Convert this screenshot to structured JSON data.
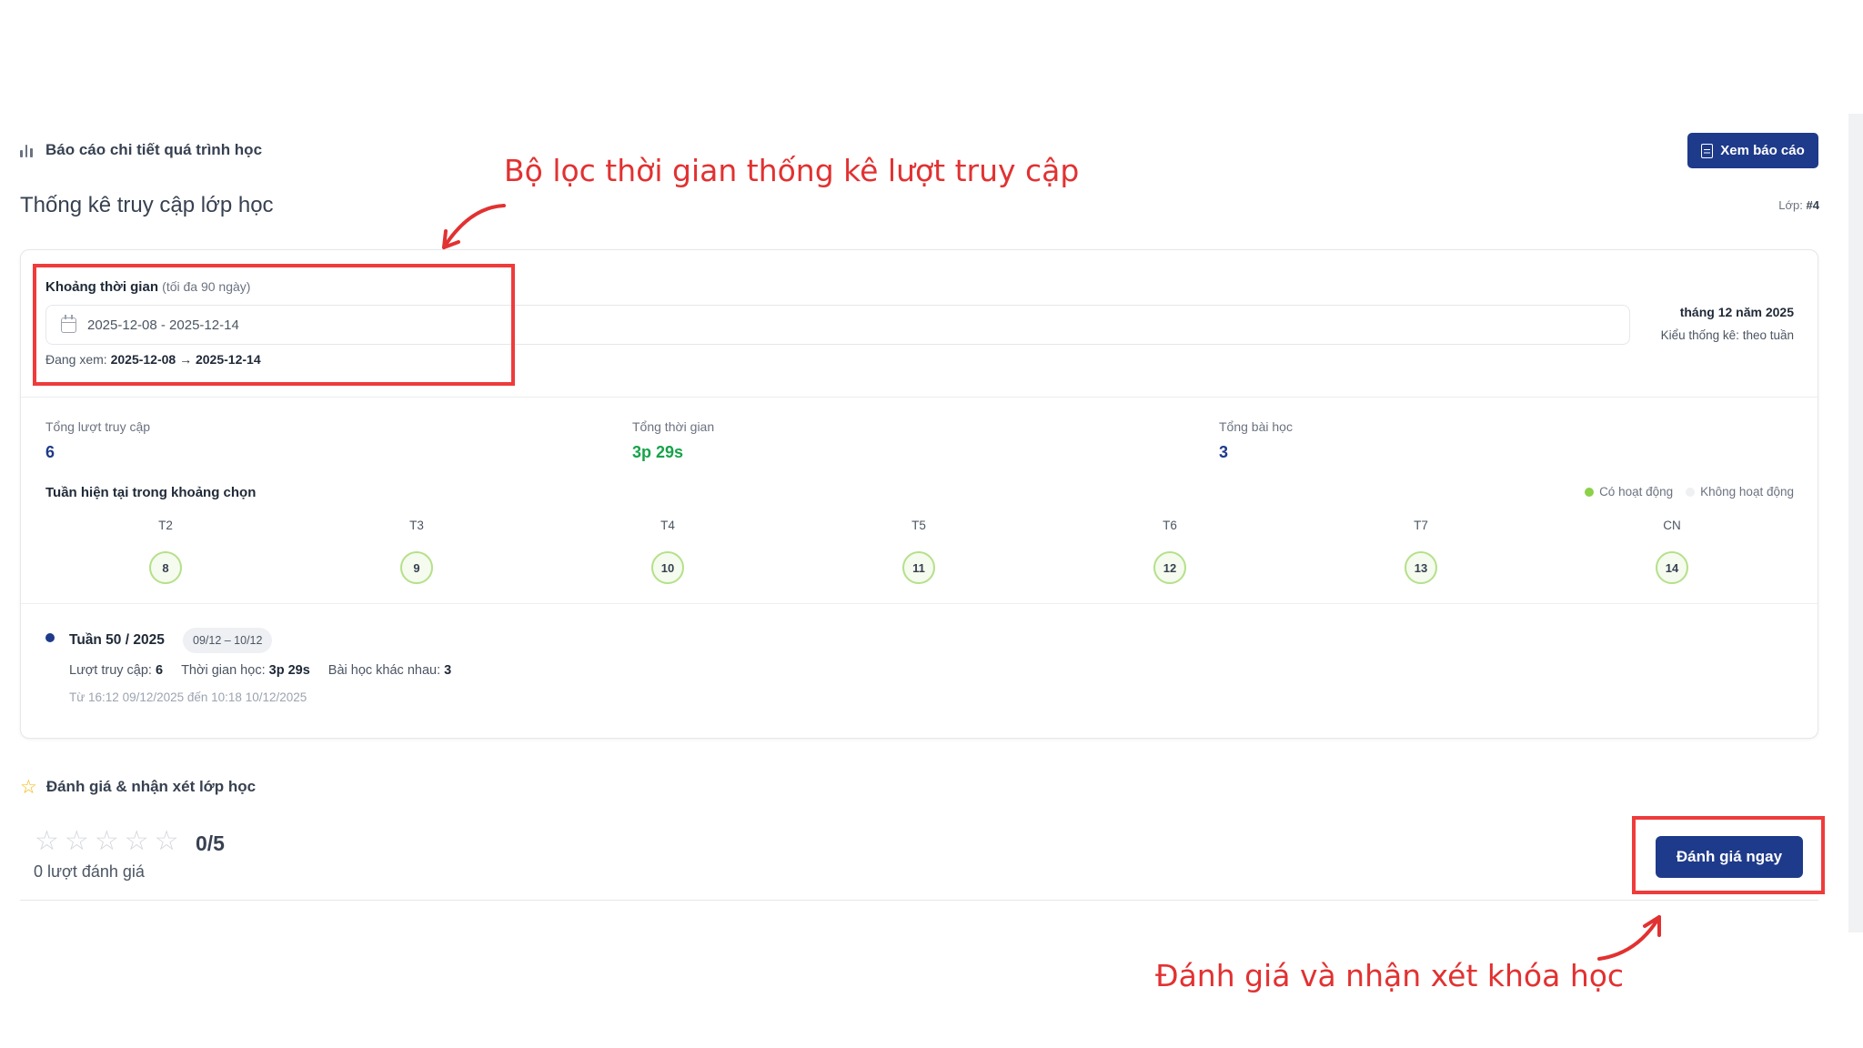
{
  "report": {
    "title": "Báo cáo chi tiết quá trình học",
    "view_button": "Xem báo cáo"
  },
  "access": {
    "title": "Thống kê truy cập lớp học",
    "class_label": "Lớp:",
    "class_value": "#4"
  },
  "filter": {
    "label": "Khoảng thời gian",
    "hint": "(tối đa 90 ngày)",
    "date_range": "2025-12-08 - 2025-12-14",
    "viewing_label": "Đang xem:",
    "viewing_range": "2025-12-08 → 2025-12-14",
    "month": "tháng 12 năm 2025",
    "stat_mode": "Kiểu thống kê: theo tuần"
  },
  "metrics": [
    {
      "label": "Tổng lượt truy cập",
      "value": "6"
    },
    {
      "label": "Tổng thời gian",
      "value": "3p 29s"
    },
    {
      "label": "Tổng bài học",
      "value": "3"
    }
  ],
  "week_view": {
    "title": "Tuần hiện tại trong khoảng chọn",
    "legend_active": "Có hoạt động",
    "legend_inactive": "Không hoạt động",
    "days": [
      {
        "label": "T2",
        "date": "8"
      },
      {
        "label": "T3",
        "date": "9"
      },
      {
        "label": "T4",
        "date": "10"
      },
      {
        "label": "T5",
        "date": "11"
      },
      {
        "label": "T6",
        "date": "12"
      },
      {
        "label": "T7",
        "date": "13"
      },
      {
        "label": "CN",
        "date": "14"
      }
    ]
  },
  "week_summary": {
    "name": "Tuần 50 / 2025",
    "range": "09/12 – 10/12",
    "visits_label": "Lượt truy cập:",
    "visits": "6",
    "time_label": "Thời gian học:",
    "time": "3p 29s",
    "lessons_label": "Bài học khác nhau:",
    "lessons": "3",
    "period": "Từ 16:12 09/12/2025 đến 10:18 10/12/2025"
  },
  "rating": {
    "title": "Đánh giá & nhận xét lớp học",
    "score": "0/5",
    "count": "0 lượt đánh giá",
    "button": "Đánh giá ngay",
    "star_count": 5
  },
  "annotations": {
    "filter_note": "Bộ lọc thời gian thống kê lượt truy cập",
    "rating_note": "Đánh giá và nhận xét khóa học",
    "color": "#e23131"
  },
  "colors": {
    "primary": "#1e3a8a",
    "success": "#16a34a",
    "active_day": "#8bd14a"
  }
}
